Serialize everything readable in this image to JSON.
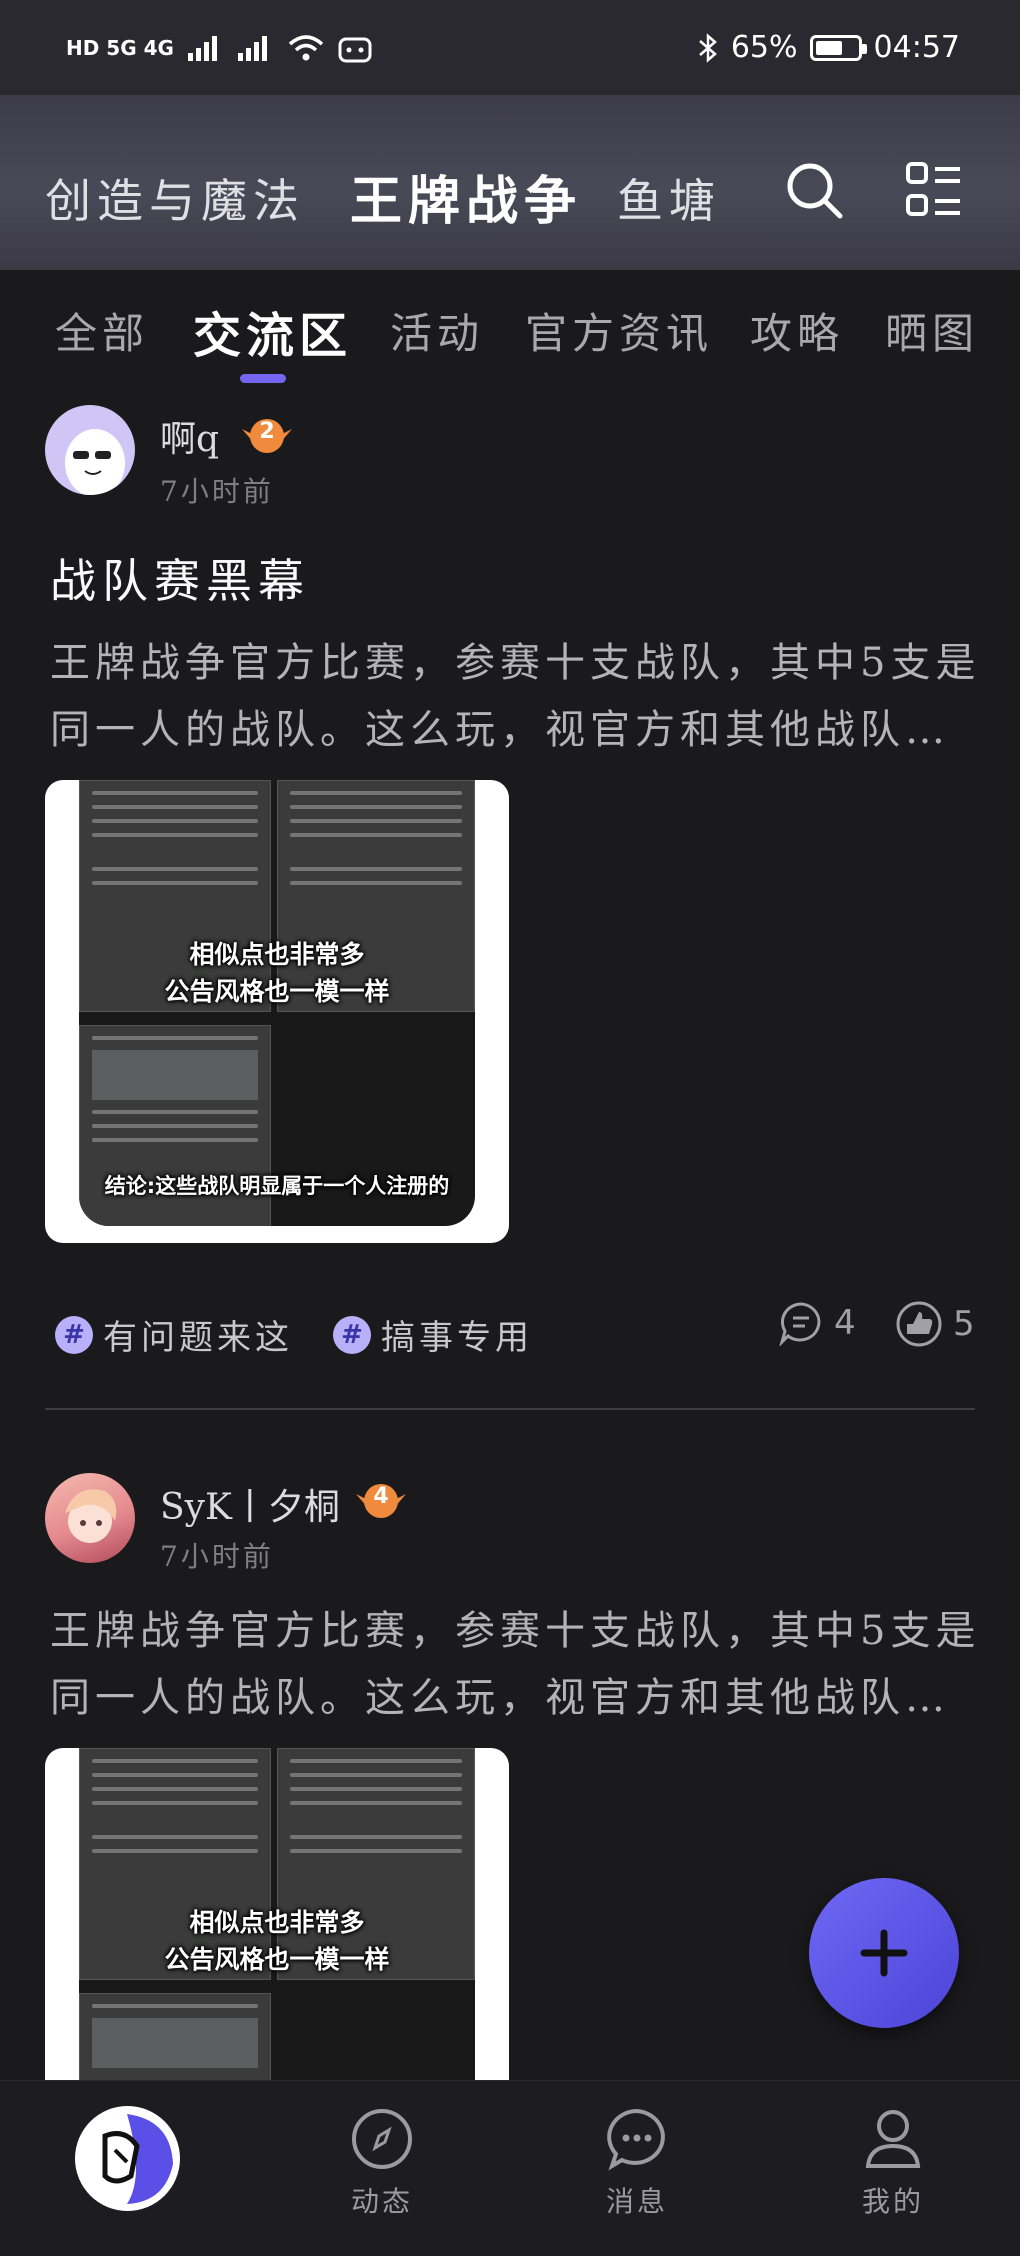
{
  "status_bar": {
    "network": "HD 5G 4G",
    "battery": "65%",
    "battery_level": 0.65,
    "time": "04:57"
  },
  "top_nav": {
    "tabs": [
      "创造与魔法",
      "王牌战争",
      "鱼塘"
    ],
    "active_tab": "王牌战争"
  },
  "sub_tabs": {
    "items": [
      "全部",
      "交流区",
      "活动",
      "官方资讯",
      "攻略",
      "晒图"
    ],
    "active": "交流区"
  },
  "posts": [
    {
      "username": "啊q",
      "level": "2",
      "time": "7小时前",
      "title": "战队赛黑幕",
      "body_line1": "王牌战争官方比赛，参赛十支战队，其中5支是",
      "body_line2": "同一人的战队。这么玩，视官方和其他战队…",
      "image_caption1": "相似点也非常多",
      "image_caption2": "公告风格也一模一样",
      "image_caption3": "结论:这些战队明显属于一个人注册的",
      "tags": [
        "有问题来这",
        "搞事专用"
      ],
      "comments": "4",
      "likes": "5"
    },
    {
      "username": "SyK丨夕桐",
      "level": "4",
      "time": "7小时前",
      "body_line1": "王牌战争官方比赛，参赛十支战队，其中5支是",
      "body_line2": "同一人的战队。这么玩，视官方和其他战队…",
      "image_caption1": "相似点也非常多",
      "image_caption2": "公告风格也一模一样"
    }
  ],
  "bottom_nav": {
    "items": [
      "动态",
      "消息",
      "我的"
    ]
  },
  "colors": {
    "accent": "#6f68f4",
    "background": "#1a191c",
    "badge": "#f08a3c"
  }
}
